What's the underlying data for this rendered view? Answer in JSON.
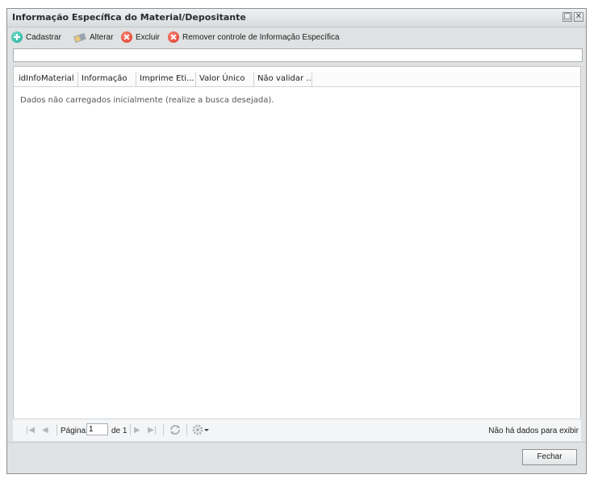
{
  "window": {
    "title": "Informação Específica do Material/Depositante",
    "restore_symbol": "□",
    "close_symbol": "✕"
  },
  "toolbar": {
    "add_label": "Cadastrar",
    "edit_label": "Alterar",
    "delete_label": "Excluir",
    "remove_label": "Remover controle de Informação Específica"
  },
  "search": {
    "value": ""
  },
  "grid": {
    "columns": [
      "idInfoMaterial",
      "Informação",
      "Imprime Eti...",
      "Valor Único",
      "Não validar ..."
    ],
    "empty_message": "Dados não carregados inicialmente (realize a busca desejada)."
  },
  "pager": {
    "page_label": "Página",
    "page_value": "1",
    "of_label": "de 1",
    "status": "Não há dados para exibir"
  },
  "footer": {
    "close_label": "Fechar"
  }
}
